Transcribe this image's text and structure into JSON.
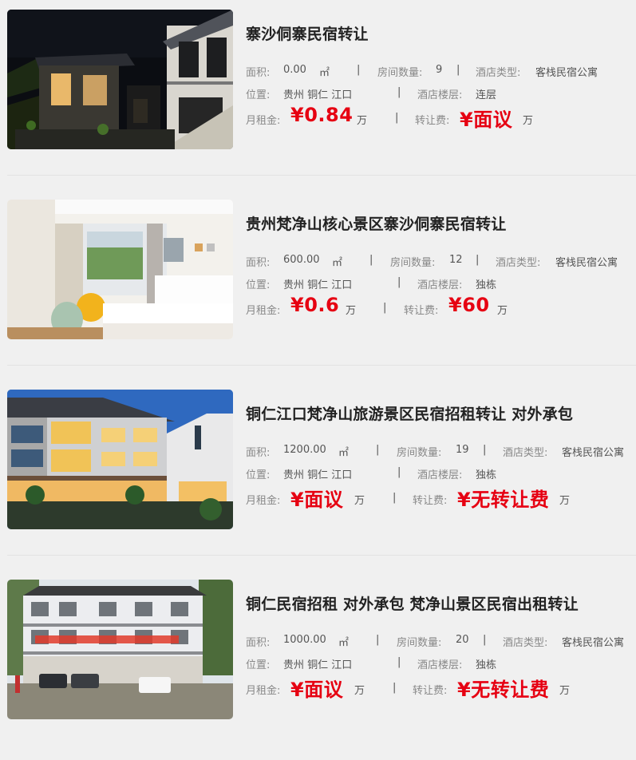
{
  "labels": {
    "area": "面积:",
    "area_unit": "㎡",
    "rooms": "房间数量:",
    "hotel_type": "酒店类型:",
    "location": "位置:",
    "floor": "酒店楼层:",
    "rent": "月租金:",
    "transfer_fee": "转让费:",
    "wan": "万",
    "separator": "|"
  },
  "listings": [
    {
      "title": "寨沙侗寨民宿转让",
      "area": "0.00",
      "rooms": "9",
      "hotel_type": "客栈民宿公寓",
      "location": "贵州 铜仁 江口",
      "floor": "连层",
      "rent": "¥0.84",
      "transfer_fee": "¥面议"
    },
    {
      "title": "贵州梵净山核心景区寨沙侗寨民宿转让",
      "area": "600.00",
      "rooms": "12",
      "hotel_type": "客栈民宿公寓",
      "location": "贵州 铜仁 江口",
      "floor": "独栋",
      "rent": "¥0.6",
      "transfer_fee": "¥60"
    },
    {
      "title": "铜仁江口梵净山旅游景区民宿招租转让 对外承包",
      "area": "1200.00",
      "rooms": "19",
      "hotel_type": "客栈民宿公寓",
      "location": "贵州 铜仁 江口",
      "floor": "独栋",
      "rent": "¥面议",
      "transfer_fee": "¥无转让费"
    },
    {
      "title": "铜仁民宿招租 对外承包 梵净山景区民宿出租转让",
      "area": "1000.00",
      "rooms": "20",
      "hotel_type": "客栈民宿公寓",
      "location": "贵州 铜仁 江口",
      "floor": "独栋",
      "rent": "¥面议",
      "transfer_fee": "¥无转让费"
    }
  ]
}
